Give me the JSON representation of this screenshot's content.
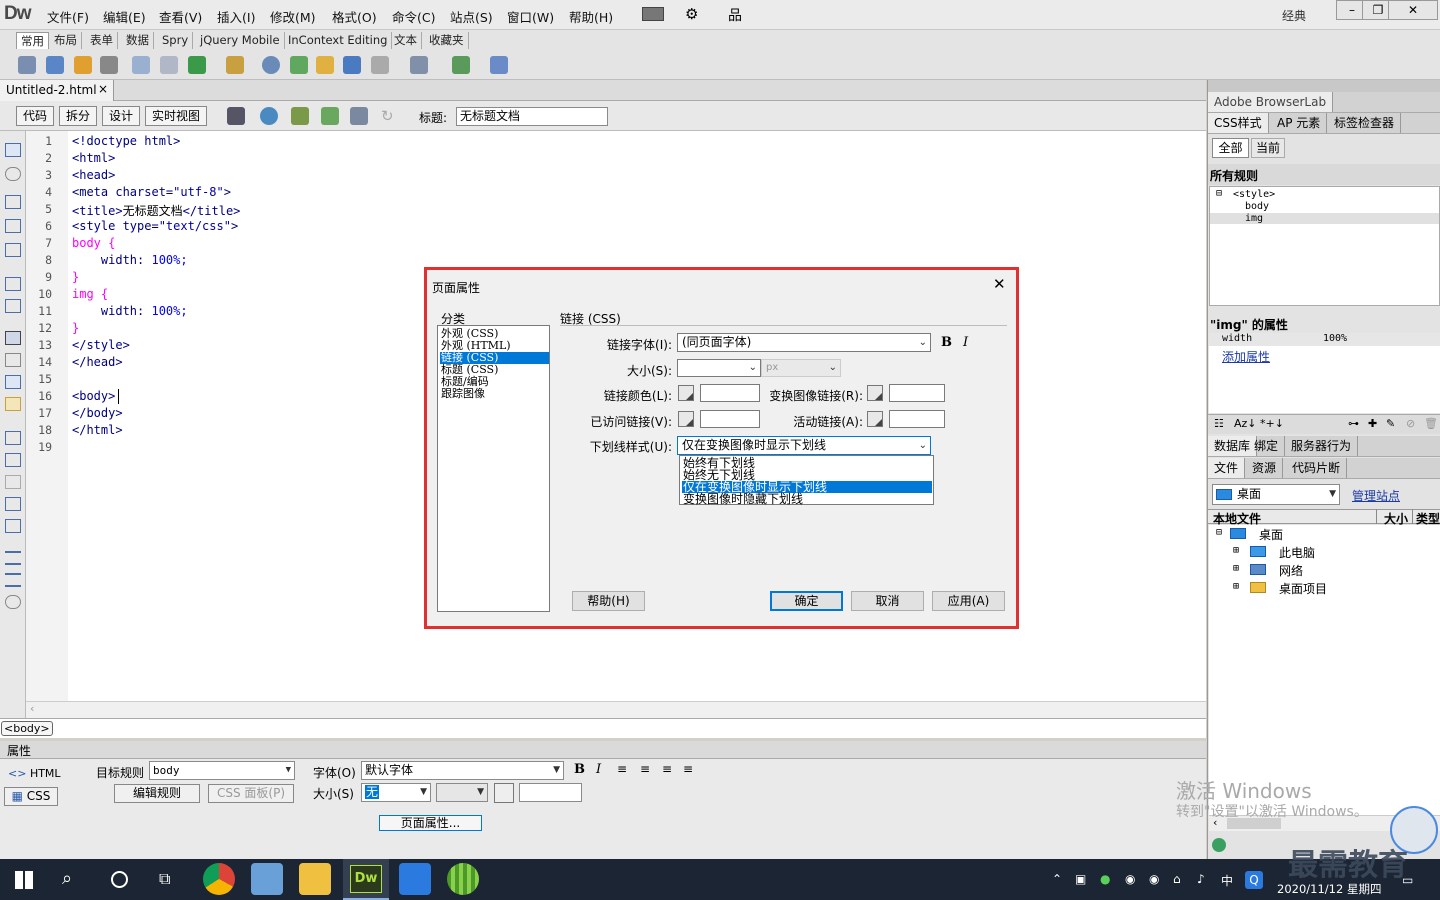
{
  "app": {
    "logo": "Dw",
    "menu": [
      "文件(F)",
      "编辑(E)",
      "查看(V)",
      "插入(I)",
      "修改(M)",
      "格式(O)",
      "命令(C)",
      "站点(S)",
      "窗口(W)",
      "帮助(H)"
    ],
    "workspace": "经典",
    "win_min": "–",
    "win_max": "❐",
    "win_close": "✕"
  },
  "insert_tabs": [
    "常用",
    "布局",
    "表单",
    "数据",
    "Spry",
    "jQuery Mobile",
    "InContext Editing",
    "文本",
    "收藏夹"
  ],
  "document": {
    "tab": "Untitled-2.html",
    "tab_close": "×",
    "views": [
      "代码",
      "拆分",
      "设计",
      "实时视图"
    ],
    "title_label": "标题:",
    "title_value": "无标题文档",
    "tag_selector": "<body>"
  },
  "code_lines": [
    "1",
    "2",
    "3",
    "4",
    "5",
    "6",
    "7",
    "8",
    "9",
    "10",
    "11",
    "12",
    "13",
    "14",
    "15",
    "16",
    "17",
    "18",
    "19"
  ],
  "code": {
    "l1": "<!doctype html>",
    "l2": "<html>",
    "l3": "<head>",
    "l4a": "<meta ",
    "l4b": "charset=",
    "l4c": "\"utf-8\"",
    "l4d": ">",
    "l5a": "<title>",
    "l5b": "无标题文档",
    "l5c": "</title>",
    "l6a": "<style ",
    "l6b": "type=",
    "l6c": "\"text/css\"",
    "l6d": ">",
    "l7": "body {",
    "l8a": "    width: ",
    "l8b": "100%;",
    "l9": "}",
    "l10": "img {",
    "l11a": "    width: ",
    "l11b": "100%;",
    "l12": "}",
    "l13": "</style>",
    "l14": "</head>",
    "l16": "<body>",
    "l17": "</body>",
    "l18": "</html>"
  },
  "properties": {
    "header": "属性",
    "html_btn": "HTML",
    "css_btn": "CSS",
    "target_rule_label": "目标规则",
    "target_rule_value": "body",
    "edit_rule": "编辑规则",
    "css_panel": "CSS 面板(P)",
    "font_label": "字体(O)",
    "font_value": "默认字体",
    "size_label": "大小(S)",
    "size_value": "无",
    "page_props": "页面属性..."
  },
  "right": {
    "browserlab": "Adobe BrowserLab",
    "css_tabs": [
      "CSS样式",
      "AP 元素",
      "标签检查器"
    ],
    "mode_all": "全部",
    "mode_current": "当前",
    "all_rules": "所有规则",
    "rules": [
      "<style>",
      "body",
      "img"
    ],
    "props_title": "\"img\" 的属性",
    "prop_name": "width",
    "prop_value": "100%",
    "add_prop": "添加属性",
    "db_tabs": [
      "数据库",
      "绑定",
      "服务器行为"
    ],
    "file_tabs": [
      "文件",
      "资源",
      "代码片断"
    ],
    "site_select": "桌面",
    "manage_sites": "管理站点",
    "col_local": "本地文件",
    "col_size": "大小",
    "col_type": "类型",
    "tree": [
      "桌面",
      "此电脑",
      "网络",
      "桌面项目"
    ]
  },
  "dialog": {
    "title": "页面属性",
    "close": "✕",
    "category_label": "分类",
    "categories": [
      "外观 (CSS)",
      "外观 (HTML)",
      "链接 (CSS)",
      "标题 (CSS)",
      "标题/编码",
      "跟踪图像"
    ],
    "selected_category": 2,
    "section": "链接 (CSS)",
    "link_font_label": "链接字体(I):",
    "link_font_value": "(同页面字体)",
    "bold": "B",
    "italic": "I",
    "size_label": "大小(S):",
    "size_unit": "px",
    "link_color_label": "链接颜色(L):",
    "rollover_label": "变换图像链接(R):",
    "visited_label": "已访问链接(V):",
    "active_label": "活动链接(A):",
    "underline_label": "下划线样式(U):",
    "underline_value": "仅在变换图像时显示下划线",
    "underline_options": [
      "始终有下划线",
      "始终无下划线",
      "仅在变换图像时显示下划线",
      "变换图像时隐藏下划线"
    ],
    "underline_selected": 2,
    "help": "帮助(H)",
    "ok": "确定",
    "cancel": "取消",
    "apply": "应用(A)"
  },
  "watermark": {
    "line1": "激活 Windows",
    "line2": "转到\"设置\"以激活 Windows。"
  },
  "taskbar": {
    "datetime": "2020/11/12 星期四",
    "ime": "中",
    "brand": "最需教育"
  }
}
